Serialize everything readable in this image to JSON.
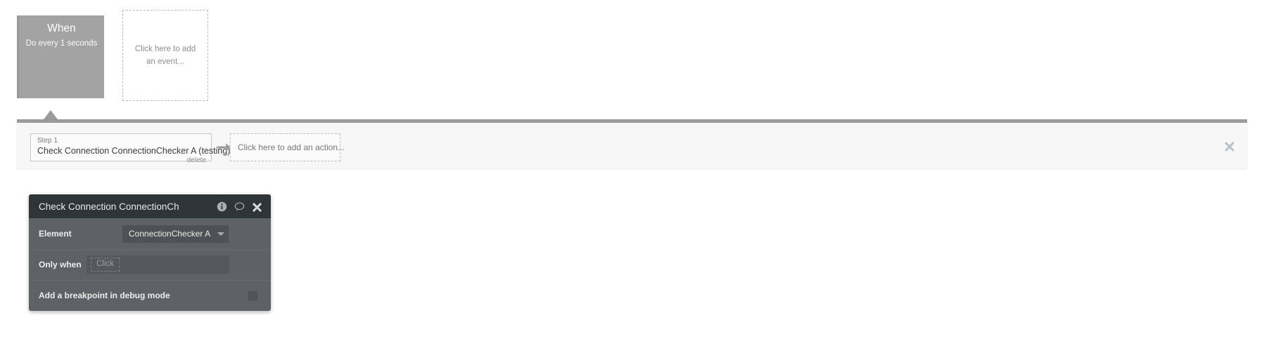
{
  "canvas": {
    "event_block": {
      "title": "When",
      "subtitle": "Do every 1 seconds",
      "bg_color": "#a3a3a3"
    },
    "add_event_placeholder": "Click here to add an event..."
  },
  "action_bar": {
    "step": {
      "index_label": "Step 1",
      "title": "Check Connection ConnectionChecker A (testing)",
      "delete_label": "delete"
    },
    "arrow_icon": "arrow-right-icon",
    "add_action_placeholder": "Click here to add an action...",
    "close_icon": "close-icon",
    "accent_color": "#9a9a9a"
  },
  "property_panel": {
    "header": {
      "title": "Check Connection ConnectionCh",
      "icons": [
        {
          "name": "info-icon"
        },
        {
          "name": "comment-icon"
        },
        {
          "name": "close-icon"
        }
      ],
      "bg_color": "#2e3538"
    },
    "rows": {
      "element": {
        "label": "Element",
        "value": "ConnectionChecker A",
        "caret_icon": "chevron-down-icon"
      },
      "only_when": {
        "label": "Only when",
        "placeholder": "Click"
      },
      "breakpoint": {
        "label": "Add a breakpoint in debug mode",
        "checked": false
      }
    },
    "bg_color": "#5d6266"
  }
}
